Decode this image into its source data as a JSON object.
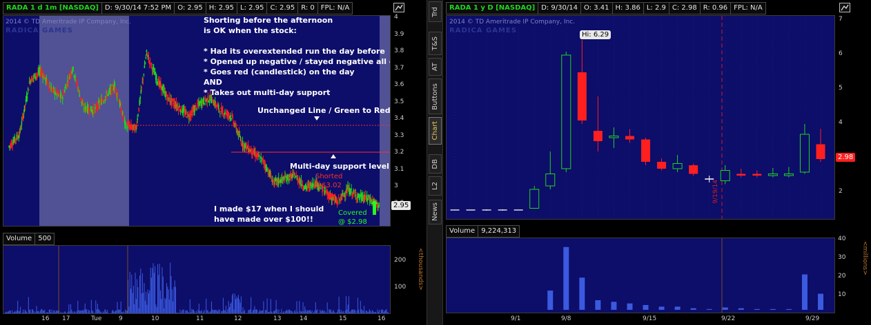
{
  "left": {
    "header": {
      "title": "RADA 1 d 1m [NASDAQ]",
      "d": "D: 9/30/14 7:52 PM",
      "o": "O: 2.95",
      "h": "H: 2.95",
      "l": "L: 2.95",
      "c": "C: 2.95",
      "r": "R: 0",
      "fpl": "FPL: N/A"
    },
    "copyright": "2014 © TD Ameritrade IP Company, Inc.",
    "brand": "RADICA GAMES",
    "y_ticks": [
      "4",
      "3.9",
      "3.8",
      "3.7",
      "3.6",
      "3.5",
      "3.4",
      "3.3",
      "3.2",
      "3.1",
      "3",
      "2.9"
    ],
    "last_price": "2.95",
    "annotations": {
      "a1": "Shorting before the afternoon",
      "a2": "is OK when the stock:",
      "a3": "* Had its overextended run the day before",
      "a4": "* Opened up negative / stayed negative all day",
      "a5": "* Goes red (candlestick) on the day",
      "a6": "AND",
      "a7": "* Takes out multi-day support",
      "unchanged": "Unchanged Line / Green to Red",
      "support": "Multi-day support level",
      "shorted": "Shorted",
      "shorted_price": "@ $3.02",
      "covered": "Covered",
      "covered_price": "@ $2.98",
      "made1": "I made $17 when I should",
      "made2": "have made over $100!!"
    },
    "volume": {
      "label": "Volume",
      "value": "500",
      "y_ticks": [
        "200",
        "100"
      ],
      "unit": "<thousands>"
    },
    "x_labels": [
      "16",
      "17",
      "Tue",
      "9",
      "10",
      "11",
      "12",
      "13",
      "14",
      "15",
      "16"
    ]
  },
  "right": {
    "header": {
      "title": "RADA 1 y D [NASDAQ]",
      "d": "D: 9/30/14",
      "o": "O: 3.41",
      "h": "H: 3.86",
      "l": "L: 2.9",
      "c": "C: 2.98",
      "r": "R: 0.96",
      "fpl": "FPL: N/A"
    },
    "copyright": "2014 © TD Ameritrade IP Company, Inc.",
    "brand": "RADICA GAMES",
    "y_ticks": [
      "7",
      "6",
      "5",
      "4",
      "3",
      "2"
    ],
    "hi_label": "Hi: 6.29",
    "last_price": "2.98",
    "date_marker": "9/19/14",
    "volume": {
      "label": "Volume",
      "value": "9,224,313",
      "y_ticks": [
        "40",
        "30",
        "20",
        "10"
      ],
      "unit": "<millions>"
    },
    "x_labels": [
      "9/1",
      "9/8",
      "9/15",
      "9/22",
      "9/29"
    ]
  },
  "side_tabs": [
    "Trd",
    "T&S",
    "AT",
    "Buttons",
    "Chart",
    "DB",
    "L2",
    "News"
  ],
  "colors": {
    "plot_bg": "#0d0d6a",
    "up": "#1fd61f",
    "down": "#ff1f1f",
    "accent": "#e8c060"
  },
  "chart_data": [
    {
      "type": "candlestick",
      "title": "RADA 1 d 1m [NASDAQ]",
      "ylim": [
        2.85,
        4.0
      ],
      "series": [
        {
          "name": "RADA",
          "values": [
            3.28,
            3.35,
            3.65,
            3.7,
            3.6,
            3.55,
            3.72,
            3.5,
            3.48,
            3.55,
            3.62,
            3.4,
            3.38,
            3.8,
            3.65,
            3.55,
            3.5,
            3.45,
            3.52,
            3.55,
            3.48,
            3.45,
            3.3,
            3.25,
            3.2,
            3.08,
            3.1,
            3.12,
            3.05,
            3.08,
            3.02,
            2.97,
            3.04,
            3.0,
            2.99,
            2.95
          ]
        }
      ],
      "price_levels": {
        "unchanged": 3.4,
        "support": 3.25
      }
    },
    {
      "type": "candlestick",
      "title": "RADA 1 y D [NASDAQ]",
      "ylim": [
        1.3,
        7.1
      ],
      "candles": [
        {
          "o": 1.5,
          "h": 1.5,
          "l": 1.5,
          "c": 1.5
        },
        {
          "o": 1.5,
          "h": 1.5,
          "l": 1.5,
          "c": 1.5
        },
        {
          "o": 1.5,
          "h": 1.52,
          "l": 1.48,
          "c": 1.5
        },
        {
          "o": 1.5,
          "h": 1.52,
          "l": 1.48,
          "c": 1.5
        },
        {
          "o": 1.5,
          "h": 1.5,
          "l": 1.5,
          "c": 1.5
        },
        {
          "o": 1.55,
          "h": 2.2,
          "l": 1.55,
          "c": 2.1
        },
        {
          "o": 2.2,
          "h": 3.2,
          "l": 2.1,
          "c": 2.55
        },
        {
          "o": 2.7,
          "h": 6.1,
          "l": 2.6,
          "c": 6.0
        },
        {
          "o": 5.5,
          "h": 6.29,
          "l": 4.0,
          "c": 4.1
        },
        {
          "o": 3.8,
          "h": 4.8,
          "l": 3.2,
          "c": 3.5
        },
        {
          "o": 3.6,
          "h": 3.9,
          "l": 3.3,
          "c": 3.65
        },
        {
          "o": 3.65,
          "h": 3.85,
          "l": 3.45,
          "c": 3.55
        },
        {
          "o": 3.55,
          "h": 3.6,
          "l": 2.8,
          "c": 2.9
        },
        {
          "o": 2.9,
          "h": 3.0,
          "l": 2.65,
          "c": 2.7
        },
        {
          "o": 2.7,
          "h": 3.1,
          "l": 2.6,
          "c": 2.85
        },
        {
          "o": 2.8,
          "h": 2.85,
          "l": 2.5,
          "c": 2.55
        },
        {
          "o": 2.4,
          "h": 2.5,
          "l": 2.3,
          "c": 2.4
        },
        {
          "o": 2.35,
          "h": 2.8,
          "l": 2.25,
          "c": 2.65
        },
        {
          "o": 2.55,
          "h": 2.7,
          "l": 2.45,
          "c": 2.5
        },
        {
          "o": 2.55,
          "h": 2.65,
          "l": 2.45,
          "c": 2.5
        },
        {
          "o": 2.5,
          "h": 2.72,
          "l": 2.45,
          "c": 2.55
        },
        {
          "o": 2.5,
          "h": 2.75,
          "l": 2.45,
          "c": 2.55
        },
        {
          "o": 2.6,
          "h": 4.0,
          "l": 2.55,
          "c": 3.7
        },
        {
          "o": 3.41,
          "h": 3.86,
          "l": 2.9,
          "c": 2.98
        }
      ],
      "volume_millions": [
        0,
        0,
        0,
        0,
        0,
        0,
        12,
        39,
        20,
        6,
        5,
        4,
        3,
        2,
        2,
        1,
        0.5,
        1.5,
        1,
        0.5,
        0.5,
        0.5,
        22,
        10
      ]
    }
  ]
}
